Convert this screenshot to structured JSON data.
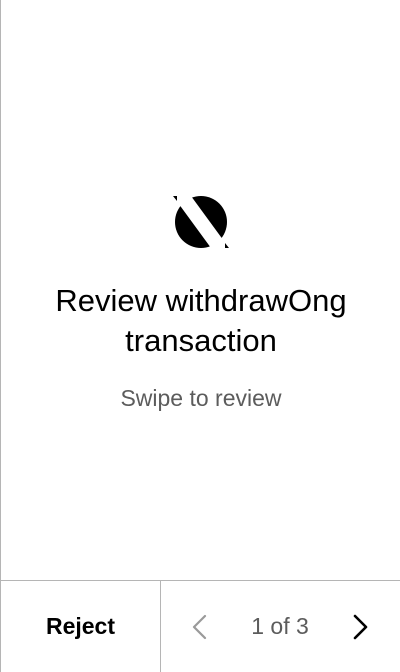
{
  "review": {
    "icon": "ontology-logo-icon",
    "title_line1": "Review withdrawOng",
    "title_line2": "transaction",
    "subtitle": "Swipe to review"
  },
  "footer": {
    "reject_label": "Reject",
    "prev_icon": "chevron-left-icon",
    "next_icon": "chevron-right-icon",
    "page_indicator": "1 of 3",
    "current_page": 1,
    "total_pages": 3
  },
  "colors": {
    "text_primary": "#000000",
    "text_secondary": "#5c5c5c",
    "divider": "#b5b5b5",
    "disabled_icon": "#9a9a9a",
    "background": "#ffffff"
  }
}
